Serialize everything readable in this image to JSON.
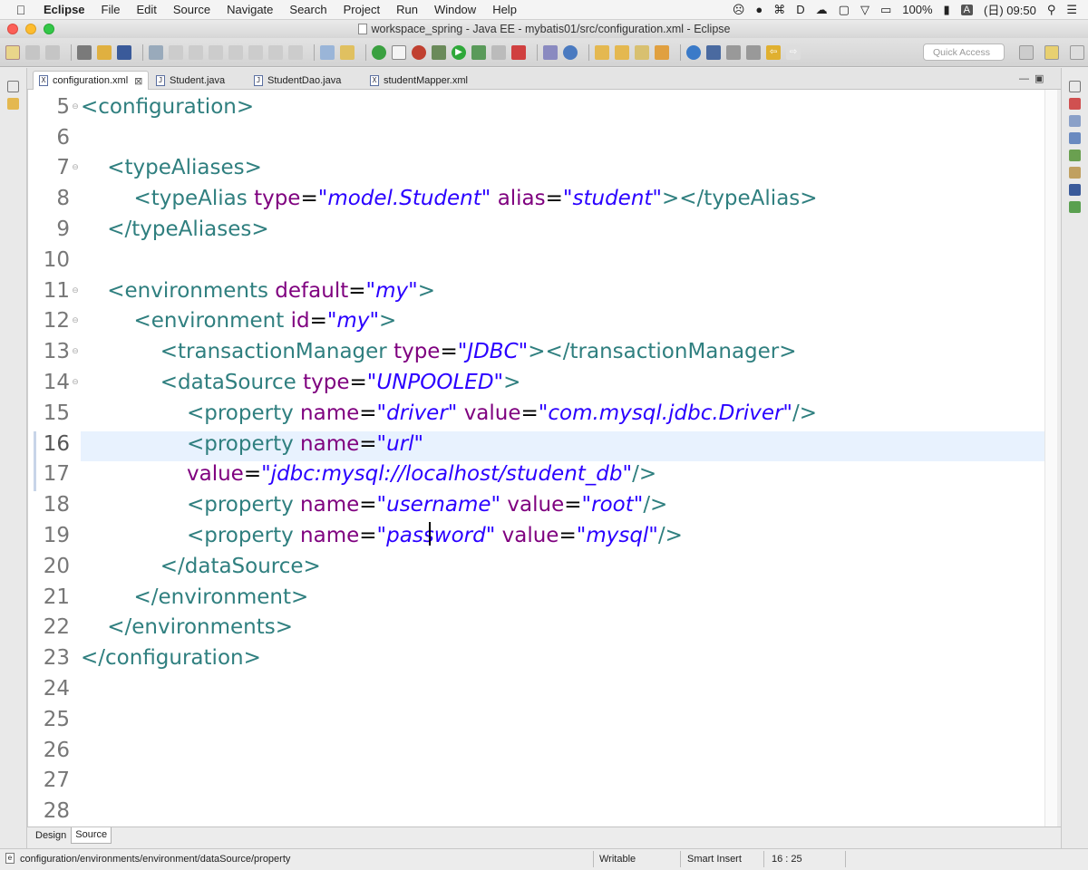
{
  "menubar": {
    "app": "Eclipse",
    "items": [
      "File",
      "Edit",
      "Source",
      "Navigate",
      "Search",
      "Project",
      "Run",
      "Window",
      "Help"
    ],
    "battery": "100%",
    "input_source": "A",
    "clock": "(日) 09:50"
  },
  "window": {
    "title": "workspace_spring - Java EE - mybatis01/src/configuration.xml - Eclipse"
  },
  "toolbar": {
    "quick_access_placeholder": "Quick Access"
  },
  "tabs": [
    {
      "label": "configuration.xml",
      "icon": "X",
      "active": true,
      "close": "⊠"
    },
    {
      "label": "Student.java",
      "icon": "J",
      "active": false
    },
    {
      "label": "StudentDao.java",
      "icon": "J",
      "active": false
    },
    {
      "label": "studentMapper.xml",
      "icon": "X",
      "active": false
    }
  ],
  "editor": {
    "current_line": 16,
    "lines": [
      {
        "n": "5",
        "fold": true,
        "tokens": [
          [
            "tg",
            "<configuration>"
          ]
        ]
      },
      {
        "n": "6",
        "fold": false,
        "tokens": []
      },
      {
        "n": "7",
        "fold": true,
        "tokens": [
          [
            "sp",
            "    "
          ],
          [
            "tg",
            "<typeAliases>"
          ]
        ]
      },
      {
        "n": "8",
        "fold": false,
        "tokens": [
          [
            "sp",
            "        "
          ],
          [
            "tg",
            "<typeAlias "
          ],
          [
            "an",
            "type"
          ],
          [
            "eq",
            "="
          ],
          [
            "av",
            "\"model.Student\""
          ],
          [
            "sp",
            " "
          ],
          [
            "an",
            "alias"
          ],
          [
            "eq",
            "="
          ],
          [
            "av",
            "\"student\""
          ],
          [
            "tg",
            "></typeAlias>"
          ]
        ]
      },
      {
        "n": "9",
        "fold": false,
        "tokens": [
          [
            "sp",
            "    "
          ],
          [
            "tg",
            "</typeAliases>"
          ]
        ]
      },
      {
        "n": "10",
        "fold": false,
        "tokens": []
      },
      {
        "n": "11",
        "fold": true,
        "tokens": [
          [
            "sp",
            "    "
          ],
          [
            "tg",
            "<environments "
          ],
          [
            "an",
            "default"
          ],
          [
            "eq",
            "="
          ],
          [
            "av",
            "\"my\""
          ],
          [
            "tg",
            ">"
          ]
        ]
      },
      {
        "n": "12",
        "fold": true,
        "tokens": [
          [
            "sp",
            "        "
          ],
          [
            "tg",
            "<environment "
          ],
          [
            "an",
            "id"
          ],
          [
            "eq",
            "="
          ],
          [
            "av",
            "\"my\""
          ],
          [
            "tg",
            ">"
          ]
        ]
      },
      {
        "n": "13",
        "fold": true,
        "tokens": [
          [
            "sp",
            "            "
          ],
          [
            "tg",
            "<transactionManager "
          ],
          [
            "an",
            "type"
          ],
          [
            "eq",
            "="
          ],
          [
            "av",
            "\"JDBC\""
          ],
          [
            "tg",
            "></transactionManager>"
          ]
        ]
      },
      {
        "n": "14",
        "fold": true,
        "tokens": [
          [
            "sp",
            "            "
          ],
          [
            "tg",
            "<dataSource "
          ],
          [
            "an",
            "type"
          ],
          [
            "eq",
            "="
          ],
          [
            "av",
            "\"UNPOOLED\""
          ],
          [
            "tg",
            ">"
          ]
        ]
      },
      {
        "n": "15",
        "fold": false,
        "tokens": [
          [
            "sp",
            "                "
          ],
          [
            "tg",
            "<property "
          ],
          [
            "an",
            "name"
          ],
          [
            "eq",
            "="
          ],
          [
            "av",
            "\"driver\""
          ],
          [
            "sp",
            " "
          ],
          [
            "an",
            "value"
          ],
          [
            "eq",
            "="
          ],
          [
            "av",
            "\"com.mysql.jdbc.Driver\""
          ],
          [
            "tg",
            "/>"
          ]
        ]
      },
      {
        "n": "16",
        "fold": false,
        "tokens": [
          [
            "sp",
            "                "
          ],
          [
            "tg",
            "<property "
          ],
          [
            "an",
            "name"
          ],
          [
            "eq",
            "="
          ],
          [
            "av",
            "\"url\""
          ]
        ]
      },
      {
        "n": "17",
        "fold": false,
        "tokens": [
          [
            "sp",
            "                "
          ],
          [
            "an",
            "value"
          ],
          [
            "eq",
            "="
          ],
          [
            "av",
            "\"jdbc:mysql://localhost/student_db\""
          ],
          [
            "tg",
            "/>"
          ]
        ]
      },
      {
        "n": "18",
        "fold": false,
        "tokens": [
          [
            "sp",
            "                "
          ],
          [
            "tg",
            "<property "
          ],
          [
            "an",
            "name"
          ],
          [
            "eq",
            "="
          ],
          [
            "av",
            "\"username\""
          ],
          [
            "sp",
            " "
          ],
          [
            "an",
            "value"
          ],
          [
            "eq",
            "="
          ],
          [
            "av",
            "\"root\""
          ],
          [
            "tg",
            "/>"
          ]
        ]
      },
      {
        "n": "19",
        "fold": false,
        "tokens": [
          [
            "sp",
            "                "
          ],
          [
            "tg",
            "<property "
          ],
          [
            "an",
            "name"
          ],
          [
            "eq",
            "="
          ],
          [
            "av",
            "\"password\""
          ],
          [
            "sp",
            " "
          ],
          [
            "an",
            "value"
          ],
          [
            "eq",
            "="
          ],
          [
            "av",
            "\"mysql\""
          ],
          [
            "tg",
            "/>"
          ]
        ]
      },
      {
        "n": "20",
        "fold": false,
        "tokens": [
          [
            "sp",
            "            "
          ],
          [
            "tg",
            "</dataSource>"
          ]
        ]
      },
      {
        "n": "21",
        "fold": false,
        "tokens": [
          [
            "sp",
            "        "
          ],
          [
            "tg",
            "</environment>"
          ]
        ]
      },
      {
        "n": "22",
        "fold": false,
        "tokens": [
          [
            "sp",
            "    "
          ],
          [
            "tg",
            "</environments>"
          ]
        ]
      },
      {
        "n": "23",
        "fold": false,
        "tokens": [
          [
            "tg",
            "</configuration>"
          ]
        ]
      },
      {
        "n": "24",
        "fold": false,
        "tokens": []
      },
      {
        "n": "25",
        "fold": false,
        "tokens": []
      },
      {
        "n": "26",
        "fold": false,
        "tokens": []
      },
      {
        "n": "27",
        "fold": false,
        "tokens": []
      },
      {
        "n": "28",
        "fold": false,
        "tokens": []
      }
    ]
  },
  "mode_tabs": {
    "design": "Design",
    "source": "Source"
  },
  "statusbar": {
    "path": "configuration/environments/environment/dataSource/property",
    "writable": "Writable",
    "insert_mode": "Smart Insert",
    "position": "16 : 25"
  }
}
